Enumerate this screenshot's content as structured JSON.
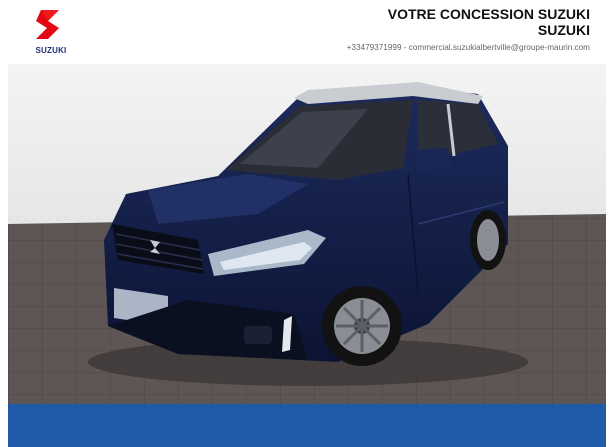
{
  "brand": {
    "logo_icon": "suzuki-s-logo-icon",
    "logo_text": "SUZUKI",
    "logo_color": "#e30613",
    "logo_text_color": "#1f2f7a"
  },
  "dealer": {
    "title_line1": "VOTRE CONCESSION SUZUKI",
    "title_line2": "SUZUKI",
    "contact": "+33479371999  - commercial.suzukialbertville@groupe-maurin.com"
  },
  "vehicle_photo": {
    "icon": "car-photo-icon"
  },
  "colors": {
    "footer_bar": "#1f5ba8",
    "floor": "#5e5654",
    "car_body": "#14204a"
  }
}
